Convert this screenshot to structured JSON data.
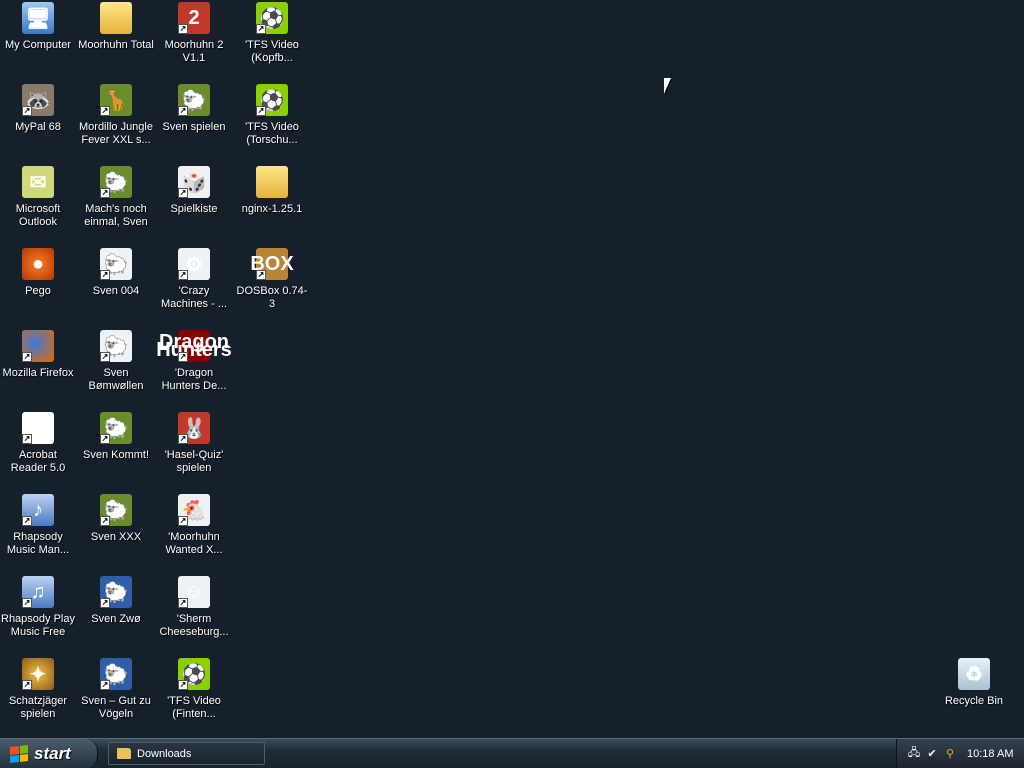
{
  "desktop": {
    "icons": [
      {
        "label": "My Computer",
        "glyph": "🖥",
        "icon": "computer-icon"
      },
      {
        "label": "Moorhuhn Total",
        "glyph": "",
        "icon": "folder-icon"
      },
      {
        "label": "Moorhuhn 2 V1.1",
        "glyph": "2",
        "icon": "moorhuhn-2-icon"
      },
      {
        "label": "'TFS Video (Kopfb...",
        "glyph": "⚽",
        "icon": "tfs-video-icon"
      },
      {
        "label": "MyPal 68",
        "glyph": "🦝",
        "icon": "mypal-icon"
      },
      {
        "label": "Mordillo Jungle Fever XXL s...",
        "glyph": "🦒",
        "icon": "mordillo-icon"
      },
      {
        "label": "Sven spielen",
        "glyph": "🐑",
        "icon": "sven-icon"
      },
      {
        "label": "'TFS Video (Torschu...",
        "glyph": "⚽",
        "icon": "tfs-video-icon"
      },
      {
        "label": "Microsoft Outlook",
        "glyph": "✉",
        "icon": "outlook-icon"
      },
      {
        "label": "Mach's noch einmal, Sven",
        "glyph": "🐑",
        "icon": "sven-icon"
      },
      {
        "label": "Spielkiste",
        "glyph": "🎲",
        "icon": "dice-icon"
      },
      {
        "label": "nginx-1.25.1",
        "glyph": "",
        "icon": "folder-icon"
      },
      {
        "label": "Pego",
        "glyph": "●",
        "icon": "pego-icon"
      },
      {
        "label": "Sven 004",
        "glyph": "🐑",
        "icon": "sven-icon"
      },
      {
        "label": "'Crazy Machines - ...",
        "glyph": "⚙",
        "icon": "crazy-machines-icon"
      },
      {
        "label": "DOSBox 0.74-3",
        "glyph": "BOX",
        "icon": "dosbox-icon"
      },
      {
        "label": "Mozilla Firefox",
        "glyph": "",
        "icon": "firefox-icon"
      },
      {
        "label": "Sven Bømwøllen",
        "glyph": "🐑",
        "icon": "sven-icon"
      },
      {
        "label": "'Dragon Hunters De...",
        "glyph": "Dragon Hunters",
        "icon": "dragon-hunters-icon"
      },
      {
        "label": "Acrobat Reader 5.0",
        "glyph": "A",
        "icon": "acrobat-icon"
      },
      {
        "label": "Sven Kommt!",
        "glyph": "🐑",
        "icon": "sven-icon"
      },
      {
        "label": "'Hasel-Quiz' spielen",
        "glyph": "🐰",
        "icon": "hasel-quiz-icon"
      },
      {
        "label": "Rhapsody Music Man...",
        "glyph": "♪",
        "icon": "rhapsody-icon"
      },
      {
        "label": "Sven XXX",
        "glyph": "🐑",
        "icon": "sven-icon"
      },
      {
        "label": "'Moorhuhn Wanted X...",
        "glyph": "🐔",
        "icon": "moorhuhn-wanted-icon"
      },
      {
        "label": "Rhapsody Play Music Free",
        "glyph": "♫",
        "icon": "rhapsody-icon"
      },
      {
        "label": "Sven Zwø",
        "glyph": "🐑",
        "icon": "sven-icon"
      },
      {
        "label": "'Sherm Cheeseburg...",
        "glyph": "☺",
        "icon": "sherm-icon"
      },
      {
        "label": "Schatzjäger spielen",
        "glyph": "✦",
        "icon": "schatzjaeger-icon"
      },
      {
        "label": "Sven – Gut zu Vögeln",
        "glyph": "🐑",
        "icon": "sven-icon"
      },
      {
        "label": "'TFS Video (Finten...",
        "glyph": "⚽",
        "icon": "tfs-video-icon"
      },
      {
        "label": "Recycle Bin",
        "glyph": "♻",
        "icon": "recycle-bin-icon"
      }
    ]
  },
  "taskbar": {
    "start_label": "start",
    "task_label": "Downloads",
    "clock": "10:18 AM"
  }
}
